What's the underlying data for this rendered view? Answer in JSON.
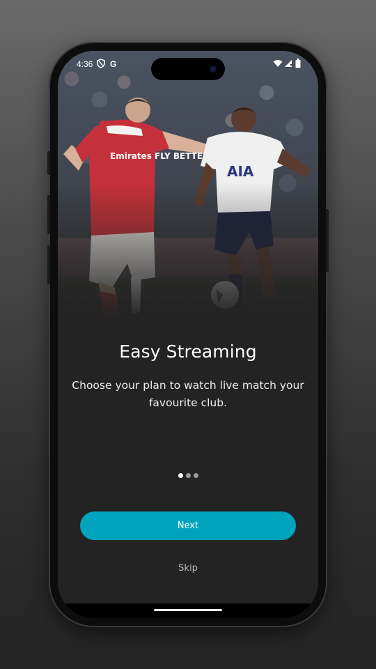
{
  "status_bar": {
    "time": "4:36",
    "left_icons": [
      "shield-icon",
      "google-icon"
    ],
    "google_glyph": "G",
    "right_icons": [
      "wifi-icon",
      "signal-icon",
      "battery-icon"
    ]
  },
  "onboarding": {
    "title": "Easy Streaming",
    "description": "Choose your plan to watch live match your favourite club.",
    "page_indicator": {
      "total": 3,
      "active": 1
    },
    "next_label": "Next",
    "skip_label": "Skip"
  },
  "hero_image": {
    "jersey_left_sponsor": "Emirates FLY BETTER",
    "jersey_right_sponsor": "AIA"
  },
  "colors": {
    "accent": "#00A3BC",
    "background": "#232323",
    "text": "#FFFFFF",
    "dot_active": "#FFFFFF",
    "dot_inactive": "#9A9A9A"
  }
}
